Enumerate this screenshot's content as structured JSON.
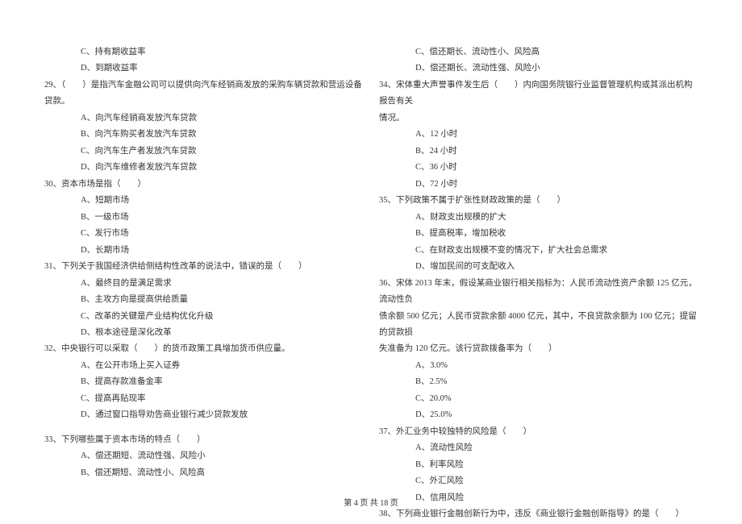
{
  "leftColumn": {
    "q28_opt_c": "C、持有期收益率",
    "q28_opt_d": "D、到期收益率",
    "q29": "29、（　　）是指汽车金融公司可以提供向汽车经销商发放的采购车辆贷款和营运设备贷款。",
    "q29_opt_a": "A、向汽车经销商发放汽车贷款",
    "q29_opt_b": "B、向汽车购买者发放汽车贷款",
    "q29_opt_c": "C、向汽车生产者发放汽车贷款",
    "q29_opt_d": "D、向汽车维修者发放汽车贷款",
    "q30": "30、资本市场是指（　　）",
    "q30_opt_a": "A、短期市场",
    "q30_opt_b": "B、一级市场",
    "q30_opt_c": "C、发行市场",
    "q30_opt_d": "D、长期市场",
    "q31": "31、下列关于我国经济供给侧结构性改革的说法中，错误的是（　　）",
    "q31_opt_a": "A、最终目的是满足需求",
    "q31_opt_b": "B、主攻方向是提高供给质量",
    "q31_opt_c": "C、改革的关键是产业结构优化升级",
    "q31_opt_d": "D、根本途径是深化改革",
    "q32": "32、中央银行可以采取（　　）的货币政策工具增加货币供应量。",
    "q32_opt_a": "A、在公开市场上买入证券",
    "q32_opt_b": "B、提高存款准备金率",
    "q32_opt_c": "C、提高再贴现率",
    "q32_opt_d": "D、通过窗口指导劝告商业银行减少贷款发放",
    "q33": "33、下列哪些属于资本市场的特点（　　）",
    "q33_opt_a": "A、偿还期短、流动性强、风险小",
    "q33_opt_b": "B、偿还期短、流动性小、风险高"
  },
  "rightColumn": {
    "q33_opt_c": "C、偿还期长、流动性小、风险高",
    "q33_opt_d": "D、偿还期长、流动性强、风险小",
    "q34": "34、宋体重大声誉事件发生后（　　）内向国务院银行业监督管理机构或其派出机构报告有关",
    "q34_cont": "情况。",
    "q34_opt_a": "A、12 小时",
    "q34_opt_b": "B、24 小时",
    "q34_opt_c": "C、36 小时",
    "q34_opt_d": "D、72 小时",
    "q35": "35、下列政策不属于扩张性财政政策的是（　　）",
    "q35_opt_a": "A、财政支出规模的扩大",
    "q35_opt_b": "B、提高税率，增加税收",
    "q35_opt_c": "C、在财政支出规模不变的情况下，扩大社会总需求",
    "q35_opt_d": "D、增加民间的可支配收入",
    "q36": "36、宋体 2013 年末，假设某商业银行相关指标为：人民币流动性资产余额 125 亿元，流动性负",
    "q36_cont1": "债余额 500 亿元；人民币贷款余额 4000 亿元，其中，不良贷款余额为 100 亿元；提留的贷款损",
    "q36_cont2": "失准备为 120 亿元。该行贷款拨备率为（　　）",
    "q36_opt_a": "A、3.0%",
    "q36_opt_b": "B、2.5%",
    "q36_opt_c": "C、20.0%",
    "q36_opt_d": "D、25.0%",
    "q37": "37、外汇业务中较独特的风险是（　　）",
    "q37_opt_a": "A、流动性风险",
    "q37_opt_b": "B、利率风险",
    "q37_opt_c": "C、外汇风险",
    "q37_opt_d": "D、信用风险",
    "q38": "38、下列商业银行金融创新行为中，违反《商业银行金融创新指导》的是（　　）"
  },
  "footer": "第 4 页 共 18 页"
}
